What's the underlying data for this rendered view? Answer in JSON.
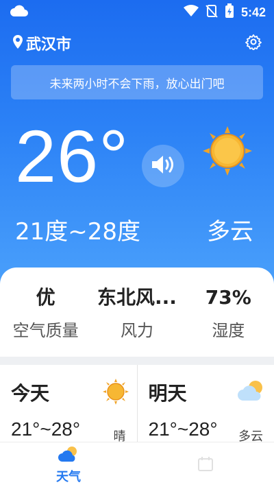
{
  "status_bar": {
    "time": "5:42"
  },
  "header": {
    "city": "武汉市"
  },
  "banner": {
    "text": "未来两小时不会下雨，放心出门吧"
  },
  "current": {
    "temperature": "26°",
    "range": "21度~28度",
    "condition": "多云"
  },
  "stats": [
    {
      "value": "优",
      "label": "空气质量"
    },
    {
      "value": "东北风...",
      "label": "风力"
    },
    {
      "value": "73%",
      "label": "湿度"
    }
  ],
  "forecast": [
    {
      "day": "今天",
      "range": "21°~28°",
      "condition": "晴",
      "icon": "sun-icon"
    },
    {
      "day": "明天",
      "range": "21°~28°",
      "condition": "多云",
      "icon": "partly-cloudy-icon"
    }
  ],
  "nav": {
    "weather_label": "天气",
    "weather_icon": "cloud-sun-icon"
  },
  "colors": {
    "accent": "#2479f0",
    "sun": "#f5a623"
  }
}
